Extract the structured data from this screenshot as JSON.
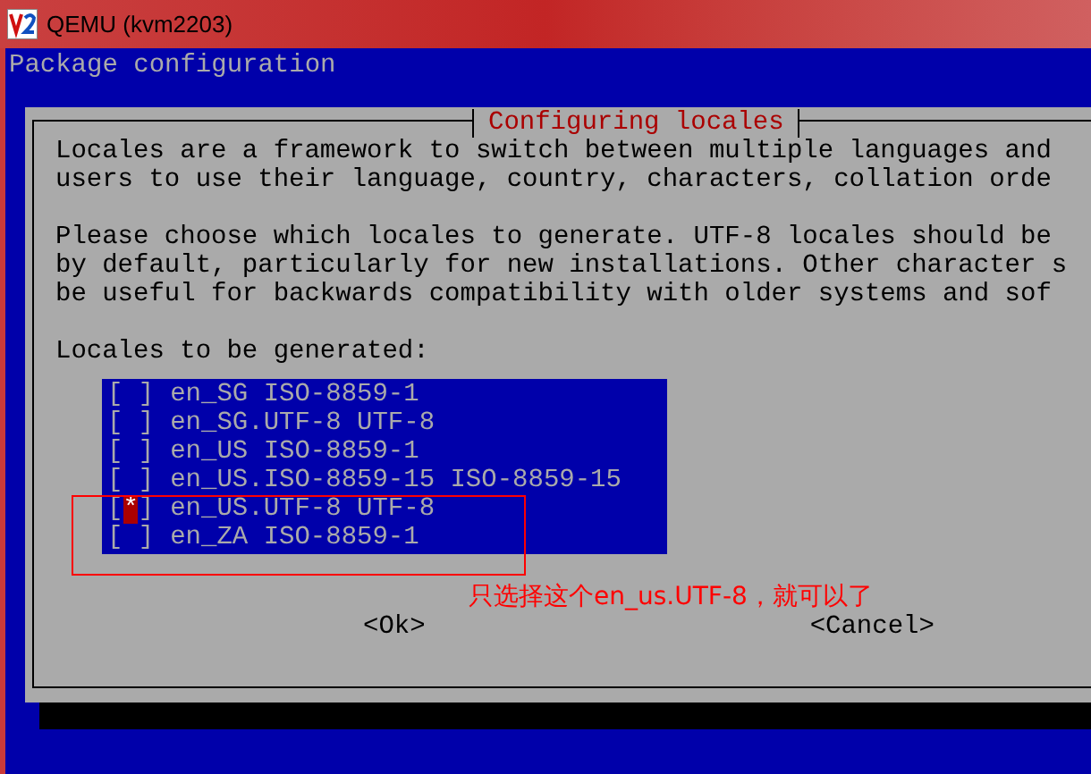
{
  "window": {
    "title": "QEMU (kvm2203)"
  },
  "header": "Package configuration",
  "dialog": {
    "title": "Configuring locales",
    "paragraphs": [
      [
        "Locales are a framework to switch between multiple languages and",
        "users to use their language, country, characters, collation orde"
      ],
      [
        "Please choose which locales to generate. UTF-8 locales should be",
        "by default, particularly for new installations. Other character s",
        "be useful for backwards compatibility with older systems and sof"
      ],
      [
        "Locales to be generated:"
      ]
    ],
    "locales": [
      {
        "checkbox": "[ ]",
        "label": "en_SG ISO-8859-1",
        "selected": false
      },
      {
        "checkbox": "[ ]",
        "label": "en_SG.UTF-8 UTF-8",
        "selected": false
      },
      {
        "checkbox": "[ ]",
        "label": "en_US ISO-8859-1",
        "selected": false
      },
      {
        "checkbox": "[ ]",
        "label": "en_US.ISO-8859-15 ISO-8859-15",
        "selected": false
      },
      {
        "checkbox": "[*]",
        "label": "en_US.UTF-8 UTF-8",
        "selected": true
      },
      {
        "checkbox": "[ ]",
        "label": "en_ZA ISO-8859-1",
        "selected": false
      }
    ],
    "buttons": [
      "<Ok>",
      "<Cancel>"
    ]
  },
  "annotation": {
    "note": "只选择这个en_us.UTF-8，就可以了"
  }
}
